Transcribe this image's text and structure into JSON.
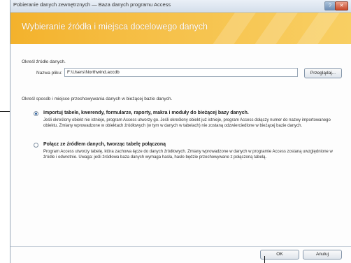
{
  "window": {
    "title": "Pobieranie danych zewnętrznych — Baza danych programu Access",
    "help_label": "?",
    "close_label": "✕"
  },
  "banner": {
    "heading": "Wybieranie źródła i miejsca docelowego danych"
  },
  "source": {
    "label": "Określ źródło danych.",
    "file_name_label": "Nazwa pliku:",
    "file_name_value": "F:\\Users\\Northwind.accdb",
    "browse_label": "Przeglądaj..."
  },
  "storage": {
    "label": "Określ sposób i miejsce przechowywania danych w bieżącej bazie danych.",
    "options": [
      {
        "title": "Importuj tabele, kwerendy, formularze, raporty, makra i moduły do bieżącej bazy danych.",
        "description": "Jeśli określony obiekt nie istnieje, program Access utworzy go. Jeśli określony obiekt już istnieje, program Access dołączy numer do nazwy importowanego obiektu. Zmiany wprowadzone w obiektach źródłowych (w tym w danych w tabelach) nie zostaną odzwierciedlone w bieżącej bazie danych.",
        "selected": true
      },
      {
        "title": "Połącz ze źródłem danych, tworząc tabelę połączoną",
        "description": "Program Access utworzy tabelę, która zachowa łącze do danych źródłowych. Zmiany wprowadzone w danych w programie Access zostaną uwzględnione w źródle i odwrotnie. Uwaga: jeśli źródłowa baza danych wymaga hasła, hasło będzie przechowywane z połączoną tabelą.",
        "selected": false
      }
    ]
  },
  "footer": {
    "ok_label": "OK",
    "cancel_label": "Anuluj"
  },
  "colors": {
    "banner": "#f4b630",
    "radio_selected": "#2c5f9e",
    "close_button": "#c94a2b"
  }
}
